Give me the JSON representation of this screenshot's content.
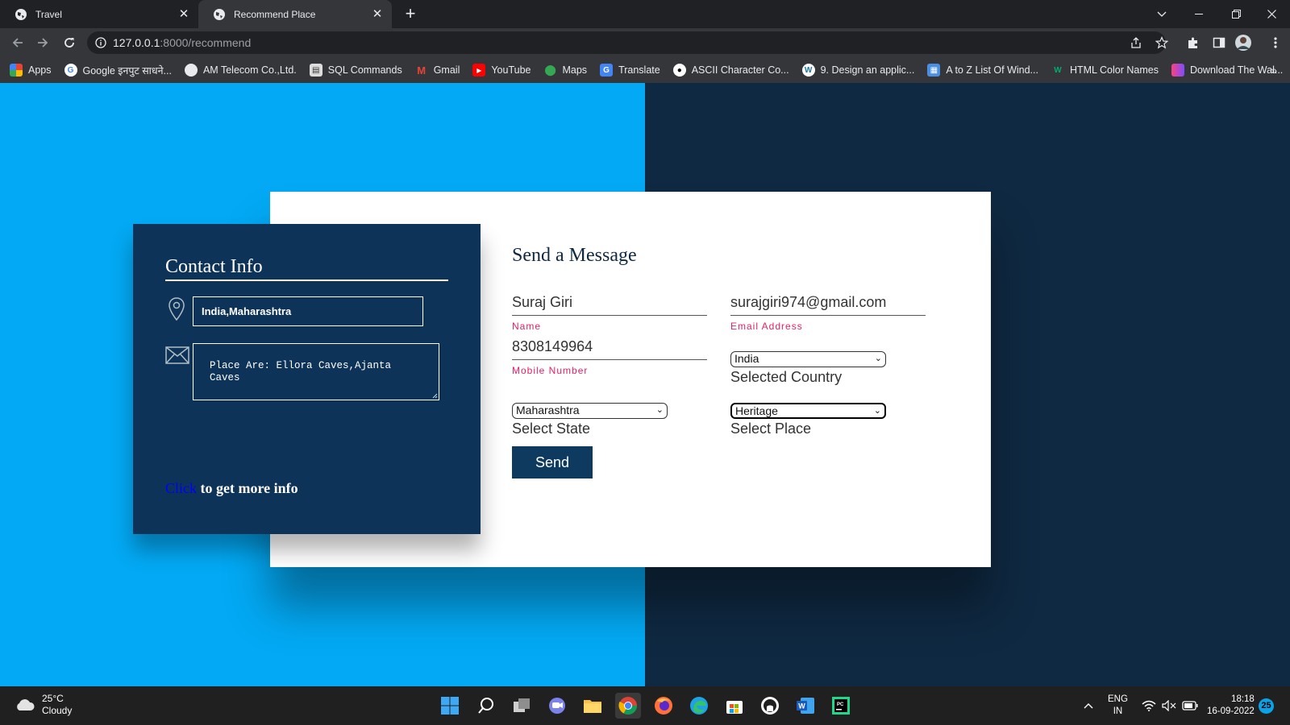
{
  "browser": {
    "tabs": [
      {
        "title": "Travel"
      },
      {
        "title": "Recommend Place"
      }
    ],
    "url_host": "127.0.0.1",
    "url_path": ":8000/recommend",
    "bookmarks": [
      {
        "label": "Apps",
        "icon": "apps-grid-icon",
        "color": "#4285f4"
      },
      {
        "label": "Google इनपुट साधने...",
        "icon": "google-icon",
        "color": "#ffffff"
      },
      {
        "label": "AM Telecom Co.,Ltd.",
        "icon": "globe-icon",
        "color": "#ffffff"
      },
      {
        "label": "SQL Commands",
        "icon": "sql-icon",
        "color": "#cccccc"
      },
      {
        "label": "Gmail",
        "icon": "gmail-icon",
        "color": "#ea4335"
      },
      {
        "label": "YouTube",
        "icon": "youtube-icon",
        "color": "#ff0000"
      },
      {
        "label": "Maps",
        "icon": "maps-icon",
        "color": "#34a853"
      },
      {
        "label": "Translate",
        "icon": "translate-icon",
        "color": "#4285f4"
      },
      {
        "label": "ASCII Character Co...",
        "icon": "ascii-icon",
        "color": "#ffffff"
      },
      {
        "label": "9. Design an applic...",
        "icon": "wordpress-icon",
        "color": "#ffffff"
      },
      {
        "label": "A to Z List Of Wind...",
        "icon": "doc-icon",
        "color": "#4a90e2"
      },
      {
        "label": "HTML Color Names",
        "icon": "w3-icon",
        "color": "#04aa6d"
      },
      {
        "label": "Download The Wal...",
        "icon": "wallpaper-icon",
        "color": "#a142f4"
      }
    ],
    "bookmarks_more": "»"
  },
  "contact_info": {
    "title": "Contact Info",
    "location": "India,Maharashtra",
    "place_text": "Place Are: Ellora Caves,Ajanta Caves",
    "more_link": "Click",
    "more_text": " to get more info"
  },
  "message_form": {
    "title": "Send a Message",
    "name": {
      "value": "Suraj Giri",
      "label": "Name"
    },
    "email": {
      "value": "surajgiri974@gmail.com",
      "label": "Email Address"
    },
    "mobile": {
      "value": "8308149964",
      "label": "Mobile Number"
    },
    "country": {
      "selected": "India",
      "caption": "Selected Country"
    },
    "state": {
      "selected": "Maharashtra",
      "caption": "Select State"
    },
    "place": {
      "selected": "Heritage",
      "caption": "Select Place"
    },
    "send_label": "Send"
  },
  "taskbar": {
    "weather_temp": "25°C",
    "weather_desc": "Cloudy",
    "lang_1": "ENG",
    "lang_2": "IN",
    "time": "18:18",
    "date": "16-09-2022",
    "notifications": "25"
  },
  "colors": {
    "page_left_bg": "#03a9f4",
    "page_right_bg": "#0f2942",
    "info_card_bg": "#0e3358",
    "label_accent": "#e91e63",
    "button_bg": "#0f3a5f"
  }
}
